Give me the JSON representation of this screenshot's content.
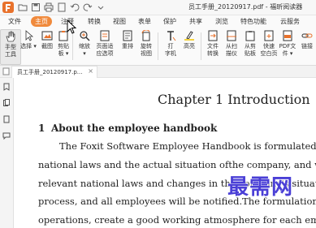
{
  "app": {
    "title": "员工手册_20120917.pdf - 福昕阅读器"
  },
  "menubar": {
    "items": [
      "文件",
      "主页",
      "注释",
      "转换",
      "视图",
      "表单",
      "保护",
      "共享",
      "浏览",
      "特色功能",
      "云服务"
    ],
    "active_index": 1
  },
  "ribbon": {
    "buttons": [
      {
        "label": "手型\n工具",
        "icon": "hand-icon"
      },
      {
        "label": "选择",
        "icon": "select-cursor-icon"
      },
      {
        "label": "截图",
        "icon": "screenshot-icon"
      },
      {
        "label": "剪贴\n板",
        "icon": "clipboard-icon"
      },
      {
        "label": "缩放",
        "icon": "zoom-icon"
      },
      {
        "label": "页面适\n应选项",
        "icon": "fit-page-icon"
      },
      {
        "label": "重排",
        "icon": "reflow-icon"
      },
      {
        "label": "旋转\n视图",
        "icon": "rotate-icon"
      },
      {
        "label": "打\n字机",
        "icon": "typewriter-icon"
      },
      {
        "label": "高亮",
        "icon": "highlight-icon"
      },
      {
        "label": "文件\n转换",
        "icon": "file-convert-icon"
      },
      {
        "label": "从扫\n描仪",
        "icon": "scanner-icon"
      },
      {
        "label": "从剪\n贴板",
        "icon": "from-clipboard-icon"
      },
      {
        "label": "快速\n空白页",
        "icon": "blank-page-icon"
      },
      {
        "label": "PDF文\n件",
        "icon": "pdf-file-icon"
      },
      {
        "label": "链接",
        "icon": "link-icon"
      }
    ]
  },
  "tab": {
    "label": "员工手册_20120917.p...",
    "close": "×"
  },
  "document": {
    "chapter_title": "Chapter 1 Introduction",
    "section_number": "1",
    "section_title": "About the employee handbook",
    "lines": [
      "The Foxit Software Employee Handbook is formulated in acco",
      "national laws and the actual situation ofthe company, and will be r",
      "relevant national laws and changes in the company's situation duri",
      "process, and all employees will be notified.The formulation of this st",
      "operations, create a good working atmosphere for each employee,"
    ]
  },
  "watermark": "最需网",
  "colors": {
    "accent": "#f08a3c",
    "logo": "#e8722c",
    "watermark": "#4a3fd6"
  }
}
